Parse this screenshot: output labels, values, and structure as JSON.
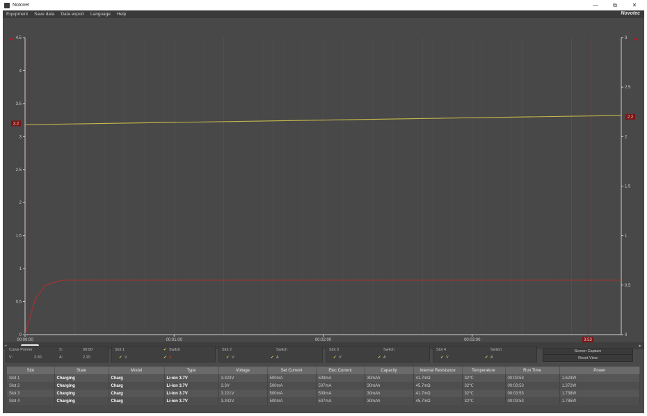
{
  "window": {
    "title": "Notover",
    "controls": [
      "—",
      "⧉",
      "✕"
    ]
  },
  "menu": [
    "Equipment",
    "Save data",
    "Data export",
    "Language",
    "Help"
  ],
  "brand": "Novotec",
  "chart_data": {
    "type": "line",
    "x_ticks": [
      "00:00:00",
      "00:01:00",
      "00:02:00",
      "00:03:00"
    ],
    "y_left": {
      "ylim": [
        0,
        4.5
      ],
      "ticks": [
        "0",
        "0.5",
        "1",
        "1.5",
        "2",
        "2.5",
        "3",
        "3.5",
        "4",
        "4.5"
      ]
    },
    "y_right": {
      "ylim": [
        0,
        3
      ],
      "ticks": [
        "0",
        "0.5",
        "1",
        "1.5",
        "2",
        "2.5",
        "3"
      ]
    },
    "x_range_seconds": [
      0,
      240
    ],
    "markers": {
      "left_value": "3.2",
      "right_value": "2.2",
      "x_end_label": "3:53"
    },
    "series": [
      {
        "axis": "left",
        "color": "#c8b84a",
        "x": [
          0,
          240
        ],
        "y": [
          3.18,
          3.32
        ]
      },
      {
        "axis": "right",
        "color": "#b03030",
        "x": [
          0,
          4,
          8,
          15,
          240
        ],
        "y": [
          0,
          0.35,
          0.5,
          0.55,
          0.55
        ]
      }
    ],
    "grid": true
  },
  "controls": {
    "cursor_label": "Curve Pointer",
    "v_label": "V:",
    "v_value": "3.30",
    "a_label": "A:",
    "a_value": "2.20",
    "s_label": "S:",
    "s_value": "00:00",
    "slot1": "Slot 1",
    "slot2": "Slot 2",
    "slot3": "Slot 3",
    "slot4": "Slot 4",
    "switch_label": "Switch",
    "check_v": "V",
    "check_a": "A"
  },
  "buttons": {
    "screen_capture": "Screen Capture",
    "reset_view": "Reset View"
  },
  "table": {
    "headers": [
      "Slot",
      "State",
      "Model",
      "Type",
      "Voltage",
      "Set Current",
      "Elec Current",
      "Capacity",
      "Internal Resistance",
      "Temperature",
      "Run Time",
      "Power"
    ],
    "rows": [
      [
        "Slot 1",
        "Charging",
        "Charg",
        "Li-ion 3.7V",
        "3.323V",
        "500mA",
        "509mA",
        "30mAh",
        "41.7mΩ",
        "32℃",
        "00:03:53",
        "1.624W"
      ],
      [
        "Slot 2",
        "Charging",
        "Charg",
        "Li-ion 3.7V",
        "3.3V",
        "500mA",
        "507mA",
        "30mAh",
        "45.7mΩ",
        "32℃",
        "00:03:53",
        "1.372W"
      ],
      [
        "Slot 3",
        "Charging",
        "Charg",
        "Li-ion 3.7V",
        "3.221V",
        "500mA",
        "509mA",
        "30mAh",
        "41.7mΩ",
        "32℃",
        "00:03:53",
        "1.738W"
      ],
      [
        "Slot 4",
        "Charging",
        "Charg",
        "Li-ion 3.7V",
        "3.342V",
        "500mA",
        "507mA",
        "30mAh",
        "45.7mΩ",
        "32℃",
        "00:03:53",
        "1.785W"
      ]
    ]
  }
}
